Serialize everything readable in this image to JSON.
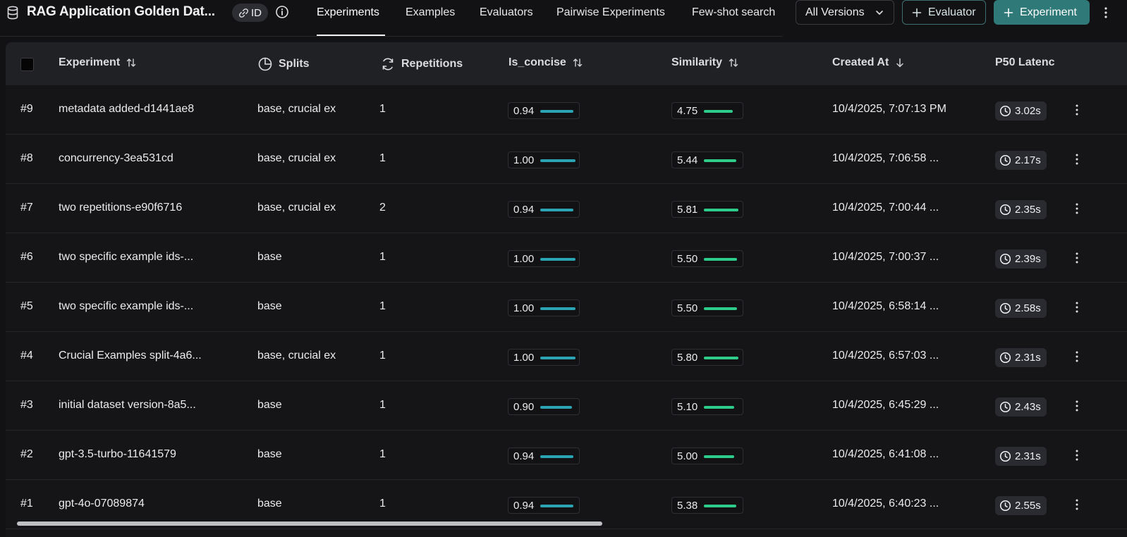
{
  "header": {
    "dataset_title": "RAG Application Golden Dat...",
    "id_chip_label": "ID",
    "tabs": [
      {
        "label": "Experiments",
        "active": true
      },
      {
        "label": "Examples",
        "active": false
      },
      {
        "label": "Evaluators",
        "active": false
      },
      {
        "label": "Pairwise Experiments",
        "active": false
      },
      {
        "label": "Few-shot search",
        "active": false
      }
    ],
    "version_select": "All Versions",
    "add_evaluator_label": "Evaluator",
    "add_experiment_label": "Experiment"
  },
  "table": {
    "columns": {
      "experiment": "Experiment",
      "splits": "Splits",
      "repetitions": "Repetitions",
      "is_concise": "Is_concise",
      "similarity": "Similarity",
      "created_at": "Created At",
      "p50_latency": "P50 Latenc"
    },
    "rows": [
      {
        "num": "#9",
        "name": "metadata added-d1441ae8",
        "splits": "base, crucial ex",
        "reps": "1",
        "is_concise": "0.94",
        "is_concise_frac": 0.94,
        "similarity": "4.75",
        "similarity_frac": 0.82,
        "created": "10/4/2025, 7:07:13 PM",
        "latency": "3.02s"
      },
      {
        "num": "#8",
        "name": "concurrency-3ea531cd",
        "splits": "base, crucial ex",
        "reps": "1",
        "is_concise": "1.00",
        "is_concise_frac": 1.0,
        "similarity": "5.44",
        "similarity_frac": 0.92,
        "created": "10/4/2025, 7:06:58 ...",
        "latency": "2.17s"
      },
      {
        "num": "#7",
        "name": "two repetitions-e90f6716",
        "splits": "base, crucial ex",
        "reps": "2",
        "is_concise": "0.94",
        "is_concise_frac": 0.94,
        "similarity": "5.81",
        "similarity_frac": 0.98,
        "created": "10/4/2025, 7:00:44 ...",
        "latency": "2.35s"
      },
      {
        "num": "#6",
        "name": "two specific example ids-...",
        "splits": "base",
        "reps": "1",
        "is_concise": "1.00",
        "is_concise_frac": 1.0,
        "similarity": "5.50",
        "similarity_frac": 0.94,
        "created": "10/4/2025, 7:00:37 ...",
        "latency": "2.39s"
      },
      {
        "num": "#5",
        "name": "two specific example ids-...",
        "splits": "base",
        "reps": "1",
        "is_concise": "1.00",
        "is_concise_frac": 1.0,
        "similarity": "5.50",
        "similarity_frac": 0.94,
        "created": "10/4/2025, 6:58:14 ...",
        "latency": "2.58s"
      },
      {
        "num": "#4",
        "name": "Crucial Examples split-4a6...",
        "splits": "base, crucial ex",
        "reps": "1",
        "is_concise": "1.00",
        "is_concise_frac": 1.0,
        "similarity": "5.80",
        "similarity_frac": 0.98,
        "created": "10/4/2025, 6:57:03 ...",
        "latency": "2.31s"
      },
      {
        "num": "#3",
        "name": "initial dataset version-8a5...",
        "splits": "base",
        "reps": "1",
        "is_concise": "0.90",
        "is_concise_frac": 0.9,
        "similarity": "5.10",
        "similarity_frac": 0.86,
        "created": "10/4/2025, 6:45:29 ...",
        "latency": "2.43s"
      },
      {
        "num": "#2",
        "name": "gpt-3.5-turbo-11641579",
        "splits": "base",
        "reps": "1",
        "is_concise": "0.94",
        "is_concise_frac": 0.94,
        "similarity": "5.00",
        "similarity_frac": 0.85,
        "created": "10/4/2025, 6:41:08 ...",
        "latency": "2.31s"
      },
      {
        "num": "#1",
        "name": "gpt-4o-07089874",
        "splits": "base",
        "reps": "1",
        "is_concise": "0.94",
        "is_concise_frac": 0.94,
        "similarity": "5.38",
        "similarity_frac": 0.92,
        "created": "10/4/2025, 6:40:23 ...",
        "latency": "2.55s"
      }
    ]
  },
  "colors": {
    "accent": "#2f7a78",
    "is_concise_bar": "#2aa3b3",
    "similarity_bar": "#2ecc8a"
  }
}
